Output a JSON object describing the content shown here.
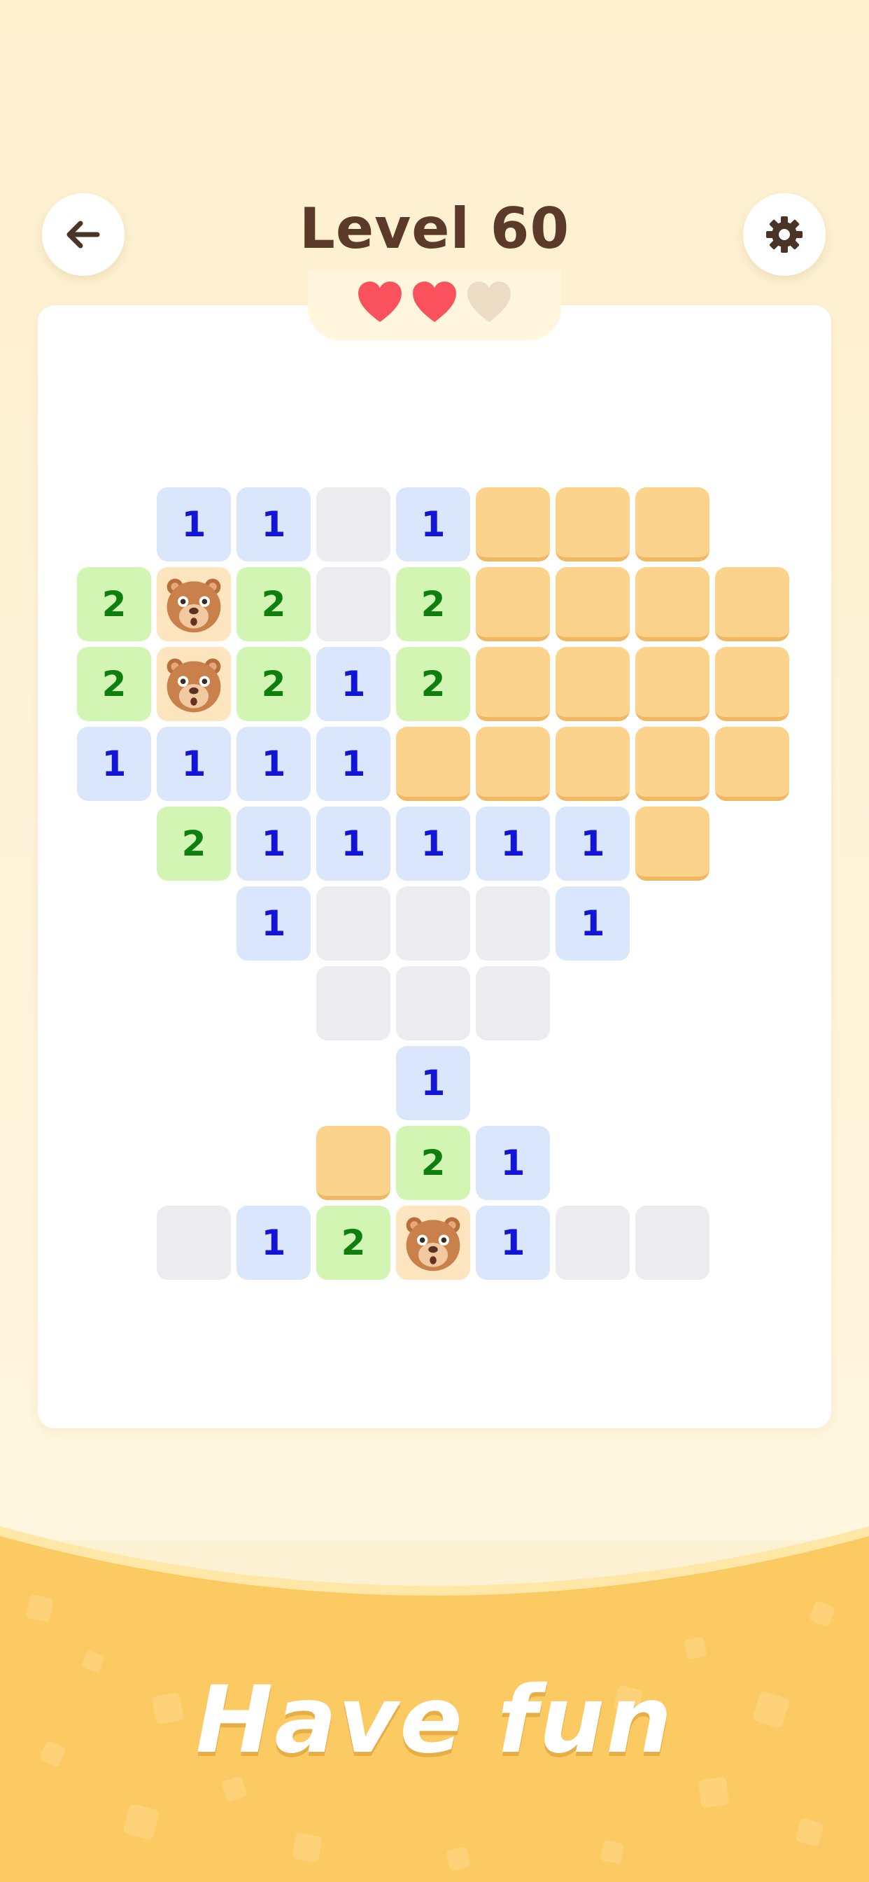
{
  "header": {
    "title": "Level 60",
    "back_icon": "arrow-left-icon",
    "settings_icon": "gear-icon"
  },
  "lives": {
    "total": 3,
    "remaining": 2
  },
  "colors": {
    "heart_full": "#f9525c",
    "heart_empty": "#ecdcc4",
    "one": "#1215d6",
    "two": "#0e7f0f",
    "closed_tile": "#fcd38d",
    "banner": "#fcca63"
  },
  "board": {
    "legend": {
      "n1": "revealed number 1",
      "n2": "revealed number 2",
      "e": "revealed empty",
      "c": "unrevealed",
      "a": "animal (mine)",
      "x": "no cell"
    },
    "rows": [
      [
        "x",
        "1",
        "1",
        "e",
        "1",
        "c",
        "c",
        "c",
        "x"
      ],
      [
        "2",
        "a",
        "2",
        "e",
        "2",
        "c",
        "c",
        "c",
        "c"
      ],
      [
        "2",
        "a",
        "2",
        "1",
        "2",
        "c",
        "c",
        "c",
        "c"
      ],
      [
        "1",
        "1",
        "1",
        "1",
        "c",
        "c",
        "c",
        "c",
        "c"
      ],
      [
        "x",
        "2",
        "1",
        "1",
        "1",
        "1",
        "1",
        "c",
        "x"
      ],
      [
        "x",
        "x",
        "1",
        "e",
        "e",
        "e",
        "1",
        "x",
        "x"
      ],
      [
        "x",
        "x",
        "x",
        "e",
        "e",
        "e",
        "x",
        "x",
        "x"
      ],
      [
        "x",
        "x",
        "x",
        "x",
        "1",
        "x",
        "x",
        "x",
        "x"
      ],
      [
        "x",
        "x",
        "x",
        "c",
        "2",
        "1",
        "x",
        "x",
        "x"
      ],
      [
        "x",
        "e",
        "1",
        "2",
        "a",
        "1",
        "e",
        "e",
        "x"
      ]
    ]
  },
  "banner": {
    "text": "Have fun"
  }
}
